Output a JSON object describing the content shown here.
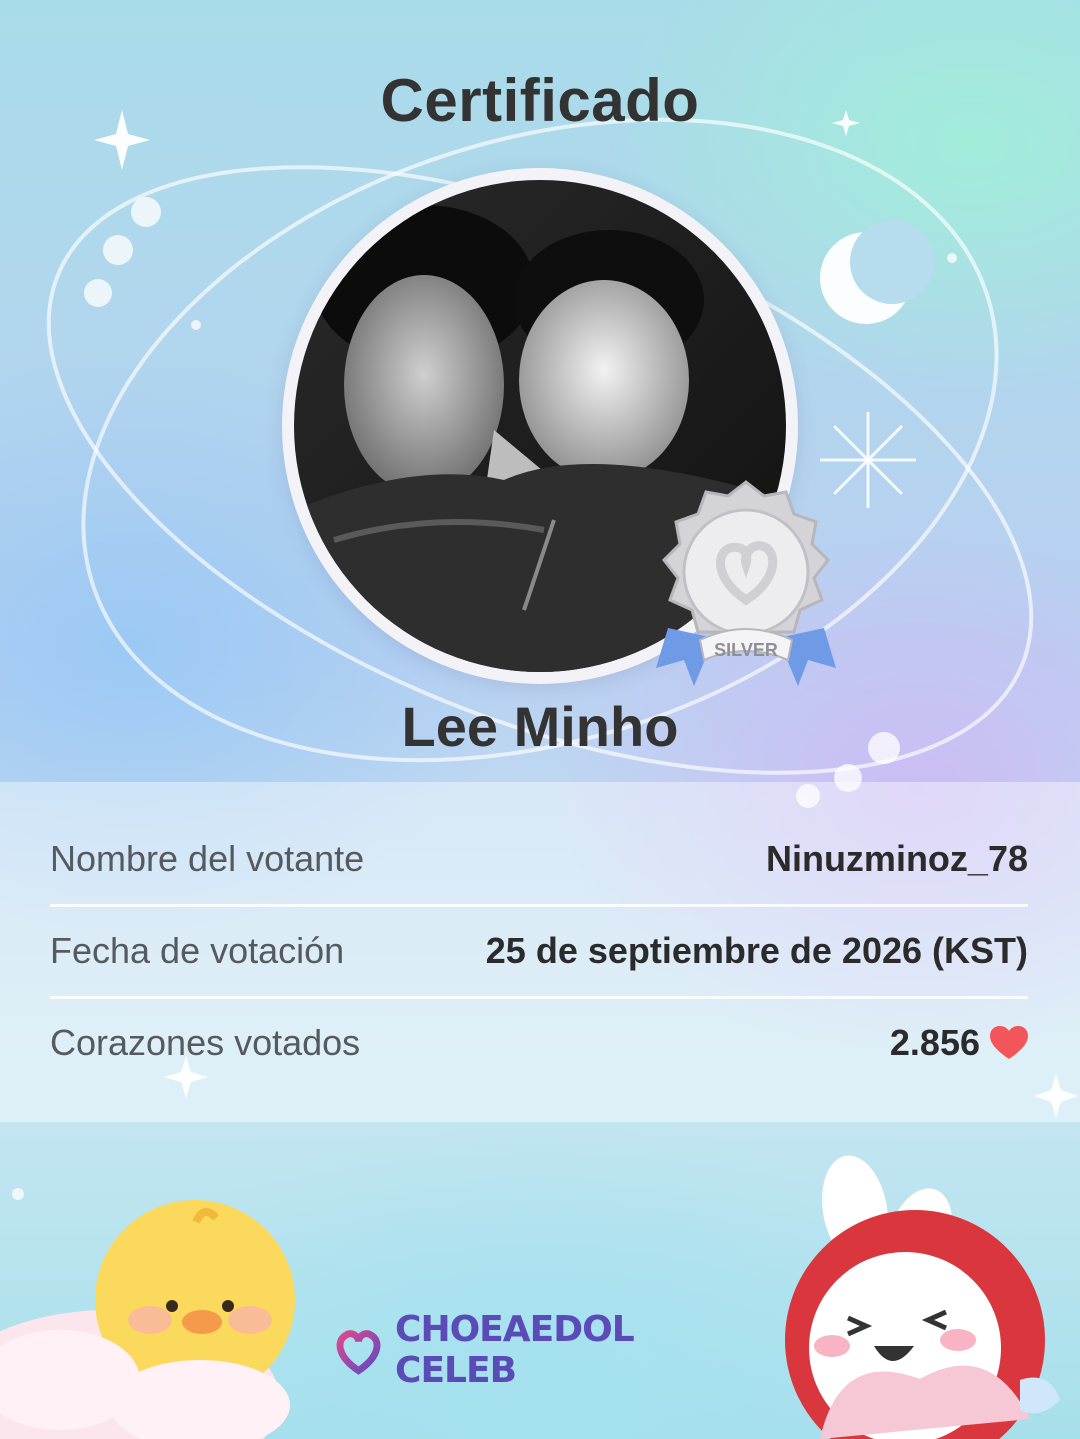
{
  "certificate": {
    "title": "Certificado",
    "celebrity_name": "Lee Minho",
    "badge_label": "SILVER",
    "rows": [
      {
        "label": "Nombre del votante",
        "value": "Ninuzminoz_78"
      },
      {
        "label": "Fecha de votación",
        "value": "25 de septiembre de 2026 (KST)"
      },
      {
        "label": "Corazones votados",
        "value": "2.856"
      }
    ],
    "heart_icon": "heart-icon",
    "brand": "CHOEAEDOL CELEB"
  },
  "colors": {
    "text_dark": "#333333",
    "heart": "#f2555a",
    "brand": "#5a4bb6",
    "badge_silver": "#c9c9cc",
    "ribbon": "#6f9ae6"
  }
}
